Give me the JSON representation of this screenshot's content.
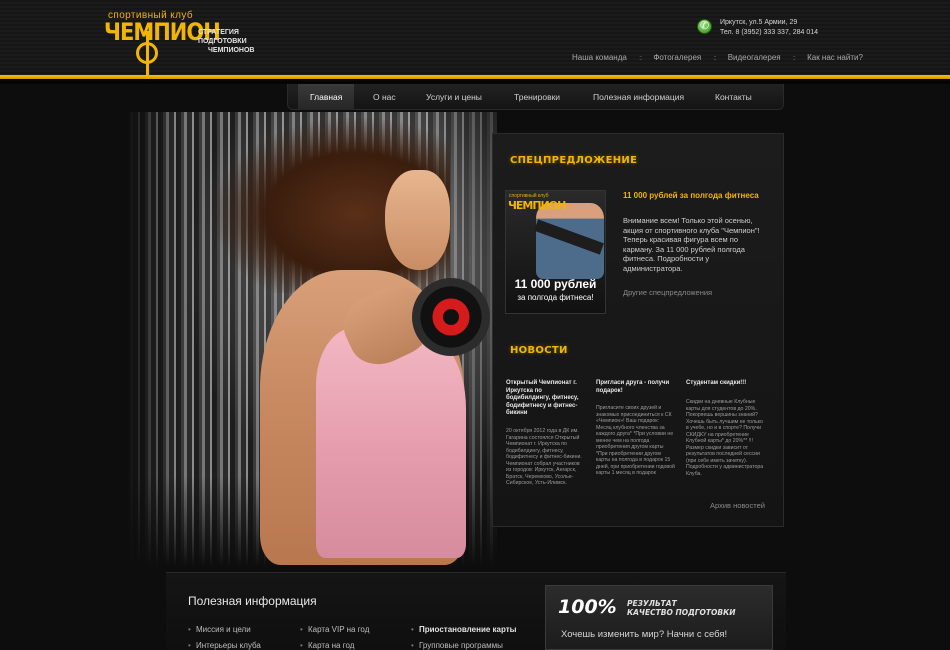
{
  "header": {
    "logo_small": "спортивный клуб",
    "logo_main": "ЧЕМПИОН",
    "slogan_line1": "СТРАТЕГИЯ ПОДГОТОВКИ",
    "slogan_line2": "ЧЕМПИОНОВ",
    "address": "Иркутск, ул.5 Армии, 29",
    "phone": "Тел. 8 (3952) 333 337, 284 014"
  },
  "top_nav": [
    "Наша команда",
    "Фотогалерея",
    "Видеогалерея",
    "Как нас найти?"
  ],
  "top_nav_separator": "::",
  "main_nav": {
    "items": [
      "Главная",
      "О нас",
      "Услуги и цены",
      "Тренировки",
      "Полезная информация",
      "Контакты"
    ],
    "active": "Главная"
  },
  "special": {
    "heading": "СПЕЦПРЕДЛОЖЕНИЕ",
    "image": {
      "small": "спортивный клуб",
      "main": "ЧЕМПИОН",
      "price": "11 000 рублей",
      "price_sub": "за полгода фитнеса!"
    },
    "title": "11 000 рублей за полгода фитнеса",
    "text": "Внимание всем! Только этой осенью, акция от спортивного клуба \"Чемпион\"! Теперь красивая фигура всем по карману. За 11 000 рублей полгода фитнеса. Подробности у администратора.",
    "more_link": "Другие спецпредложения"
  },
  "news": {
    "heading": "НОВОСТИ",
    "items": [
      {
        "title": "Открытый Чемпионат г. Иркутска по бодибилдингу, фитнесу, бодифитнесу и фитнес-бикини",
        "text": "20 октября 2012 года в ДК им. Гагарина состоялся Открытый Чемпионат г. Иркутска по бодибилдингу, фитнесу, бодифитнесу и фитнес-бикини. Чемпионат собрал участников из городов: Иркутск, Ангарск, Братск, Черемхово, Усолье-Сибирское, Усть-Илимск."
      },
      {
        "title": "Пригласи друга - получи подарок!",
        "text": "Пригласите своих друзей и знакомых присоединиться к СК «Чемпион»! Ваш подарок: Месяц клубного членства за каждого друга* *При условии не менее чем на полгода приобретения другом карты *При приобретении другом карты на полгода в подарок 15 дней, при приобретении годовой карты 1 месяц в подарок"
      },
      {
        "title": "Студентам скидки!!!",
        "text": "Скидки на дневные Клубные карты для студентов до 20%. Покоряешь вершины знаний? Хочешь быть лучшим не только в учебе, но и в спорте? Получи СКИДКУ на приобретение Клубной карты* до 20%** !!! Размер скидки зависит от результатов последней сессии (при себе иметь зачетку). Подробности у администратора Клуба."
      }
    ],
    "archive_link": "Архив новостей"
  },
  "info": {
    "heading": "Полезная информация",
    "col1": [
      "Миссия и цели",
      "Интерьеры клуба"
    ],
    "col2": [
      "Карта VIP на год",
      "Карта на год"
    ],
    "col3": [
      "Приостановление карты",
      "Групповые программы"
    ],
    "bullet": "•"
  },
  "result": {
    "percent": "100%",
    "line1": "РЕЗУЛЬТАТ",
    "line2": "КАЧЕСТВО ПОДГОТОВКИ",
    "quote": "Хочешь изменить мир? Начни с себя!"
  },
  "colors": {
    "accent": "#f2b600",
    "background": "#0d0d0d",
    "dumbbell_red": "#d51b1b"
  }
}
